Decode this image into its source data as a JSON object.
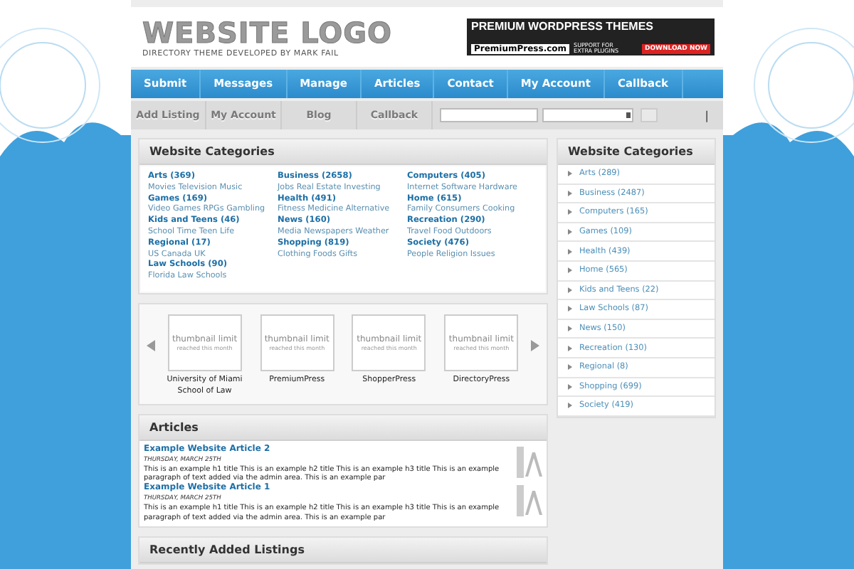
{
  "header": {
    "logo": "WEBSITE LOGO",
    "tagline": "DIRECTORY THEME DEVELOPED BY MARK FAIL",
    "banner": {
      "title": "PREMIUM WORDPRESS THEMES",
      "brand": "PremiumPress.com",
      "note": "SUPPORT FOR EXTRA PLUGINS",
      "cta": "DOWNLOAD NOW"
    }
  },
  "nav": [
    "Submit",
    "Messages",
    "Manage",
    "Articles",
    "Contact",
    "My Account",
    "Callback"
  ],
  "subnav": [
    "Add Listing",
    "My Account",
    "Blog",
    "Callback"
  ],
  "search_bar": {
    "divider": "|"
  },
  "categories": {
    "title": "Website Categories",
    "columns": [
      [
        {
          "name": "Arts (369)",
          "sub": "Movies Television Music"
        },
        {
          "name": "Games (169)",
          "sub": "Video Games RPGs Gambling"
        },
        {
          "name": "Kids and Teens (46)",
          "sub": "School Time Teen Life"
        },
        {
          "name": "Regional (17)",
          "sub": "US Canada UK"
        },
        {
          "name": "Law Schools (90)",
          "sub": "Florida Law Schools"
        }
      ],
      [
        {
          "name": "Business (2658)",
          "sub": "Jobs Real Estate Investing"
        },
        {
          "name": "Health (491)",
          "sub": "Fitness Medicine Alternative"
        },
        {
          "name": "News (160)",
          "sub": "Media Newspapers Weather"
        },
        {
          "name": "Shopping (819)",
          "sub": "Clothing Foods Gifts"
        }
      ],
      [
        {
          "name": "Computers (405)",
          "sub": "Internet Software Hardware"
        },
        {
          "name": "Home (615)",
          "sub": "Family Consumers Cooking"
        },
        {
          "name": "Recreation (290)",
          "sub": "Travel Food Outdoors"
        },
        {
          "name": "Society (476)",
          "sub": "People Religion Issues"
        }
      ]
    ]
  },
  "carousel": {
    "items": [
      {
        "thumb": "thumbnail limit",
        "thumb_note": "reached this month",
        "caption": "University of Miami School of Law"
      },
      {
        "thumb": "thumbnail limit",
        "thumb_note": "reached this month",
        "caption": "PremiumPress"
      },
      {
        "thumb": "thumbnail limit",
        "thumb_note": "reached this month",
        "caption": "ShopperPress"
      },
      {
        "thumb": "thumbnail limit",
        "thumb_note": "reached this month",
        "caption": "DirectoryPress"
      }
    ]
  },
  "articles": {
    "title": "Articles",
    "items": [
      {
        "title": "Example Website Article 2",
        "date": "THURSDAY, MARCH 25TH",
        "excerpt": "This is an example h1 title This is an example h2 title This is an example h3 title This is an example paragraph of text added via the admin area. This is an example par"
      },
      {
        "title": "Example Website Article 1",
        "date": "THURSDAY, MARCH 25TH",
        "excerpt": "This is an example h1 title This is an example h2 title This is an example h3 title This is an example paragraph of text added via the admin area. This is an example par"
      }
    ]
  },
  "recent": {
    "title": "Recently Added Listings"
  },
  "sidebar": {
    "title": "Website Categories",
    "items": [
      "Arts (289)",
      "Business (2487)",
      "Computers (165)",
      "Games (109)",
      "Health (439)",
      "Home (565)",
      "Kids and Teens (22)",
      "Law Schools (87)",
      "News (150)",
      "Recreation (130)",
      "Regional (8)",
      "Shopping (699)",
      "Society (419)"
    ]
  }
}
